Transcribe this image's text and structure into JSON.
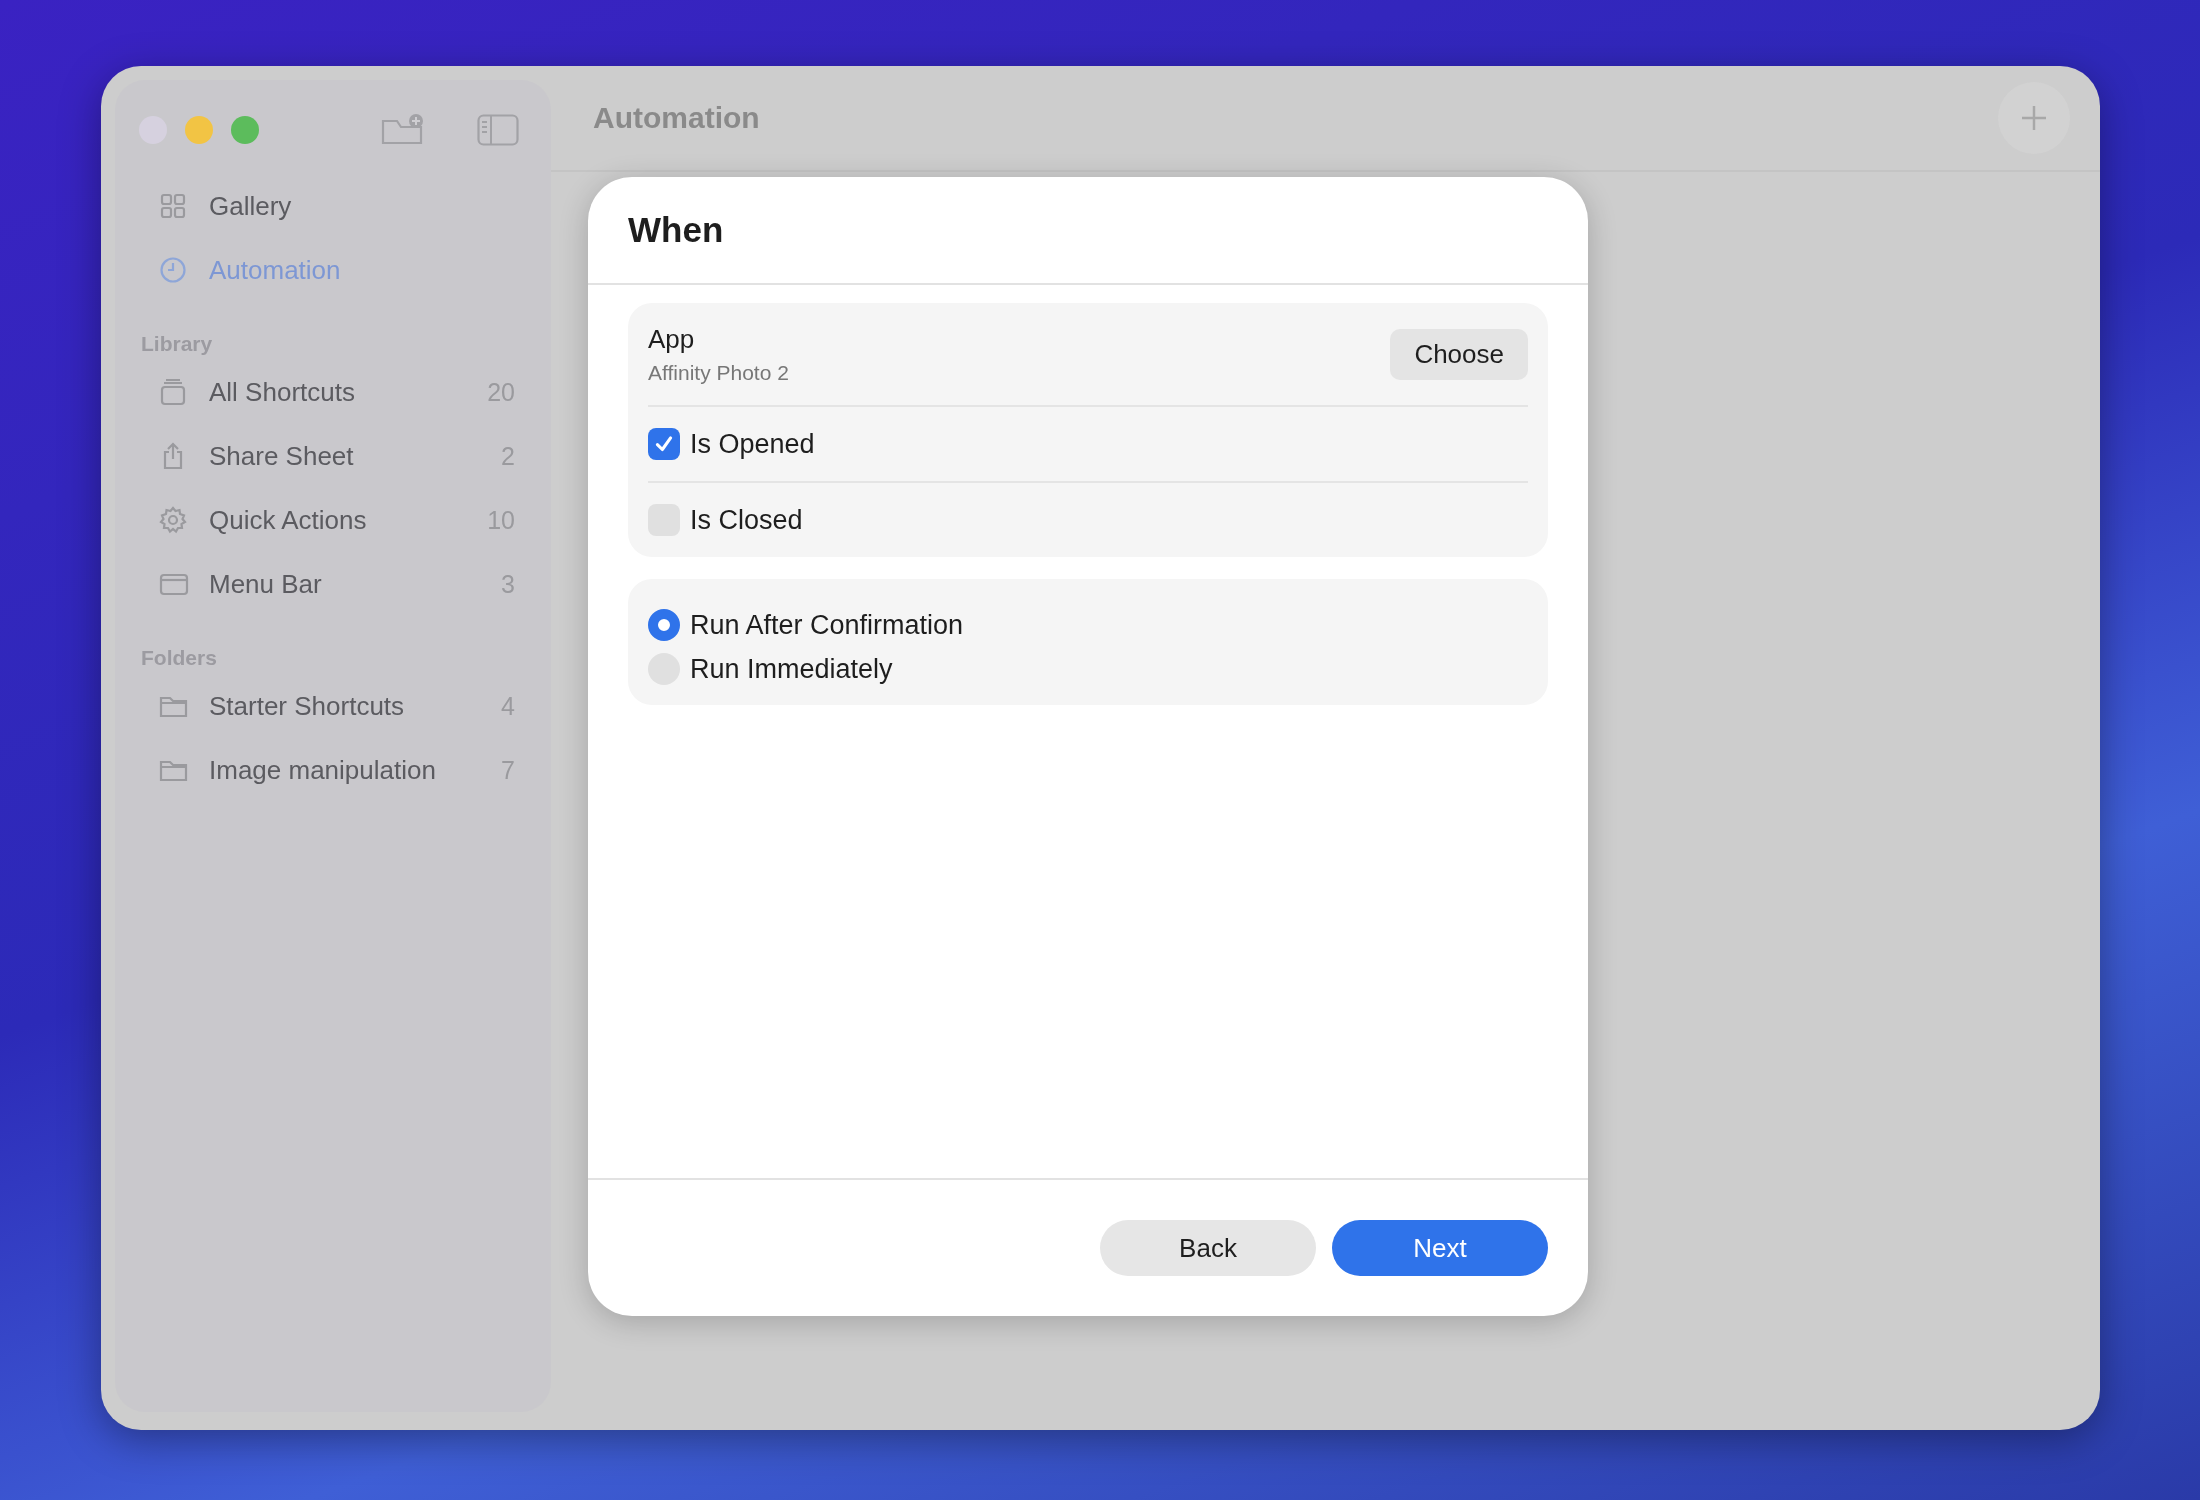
{
  "window": {
    "title": "Automation"
  },
  "sidebar": {
    "top_items": [
      {
        "label": "Gallery",
        "kind": "gallery",
        "selected": false
      },
      {
        "label": "Automation",
        "kind": "automation",
        "selected": true
      }
    ],
    "sections": [
      {
        "heading": "Library",
        "items": [
          {
            "label": "All Shortcuts",
            "kind": "stack",
            "count": "20"
          },
          {
            "label": "Share Sheet",
            "kind": "share",
            "count": "2"
          },
          {
            "label": "Quick Actions",
            "kind": "gear",
            "count": "10"
          },
          {
            "label": "Menu Bar",
            "kind": "menubar",
            "count": "3"
          }
        ]
      },
      {
        "heading": "Folders",
        "items": [
          {
            "label": "Starter Shortcuts",
            "kind": "folder",
            "count": "4"
          },
          {
            "label": "Image manipulation",
            "kind": "folder",
            "count": "7"
          }
        ]
      }
    ]
  },
  "dialog": {
    "title": "When",
    "trigger": {
      "label": "App",
      "value": "Affinity Photo 2",
      "button": "Choose"
    },
    "options": [
      {
        "label": "Is Opened",
        "checked": true
      },
      {
        "label": "Is Closed",
        "checked": false
      }
    ],
    "run_modes": [
      {
        "label": "Run After Confirmation",
        "selected": true
      },
      {
        "label": "Run Immediately",
        "selected": false
      }
    ],
    "buttons": [
      {
        "label": "Back",
        "kind": "secondary"
      },
      {
        "label": "Next",
        "kind": "primary"
      }
    ]
  }
}
